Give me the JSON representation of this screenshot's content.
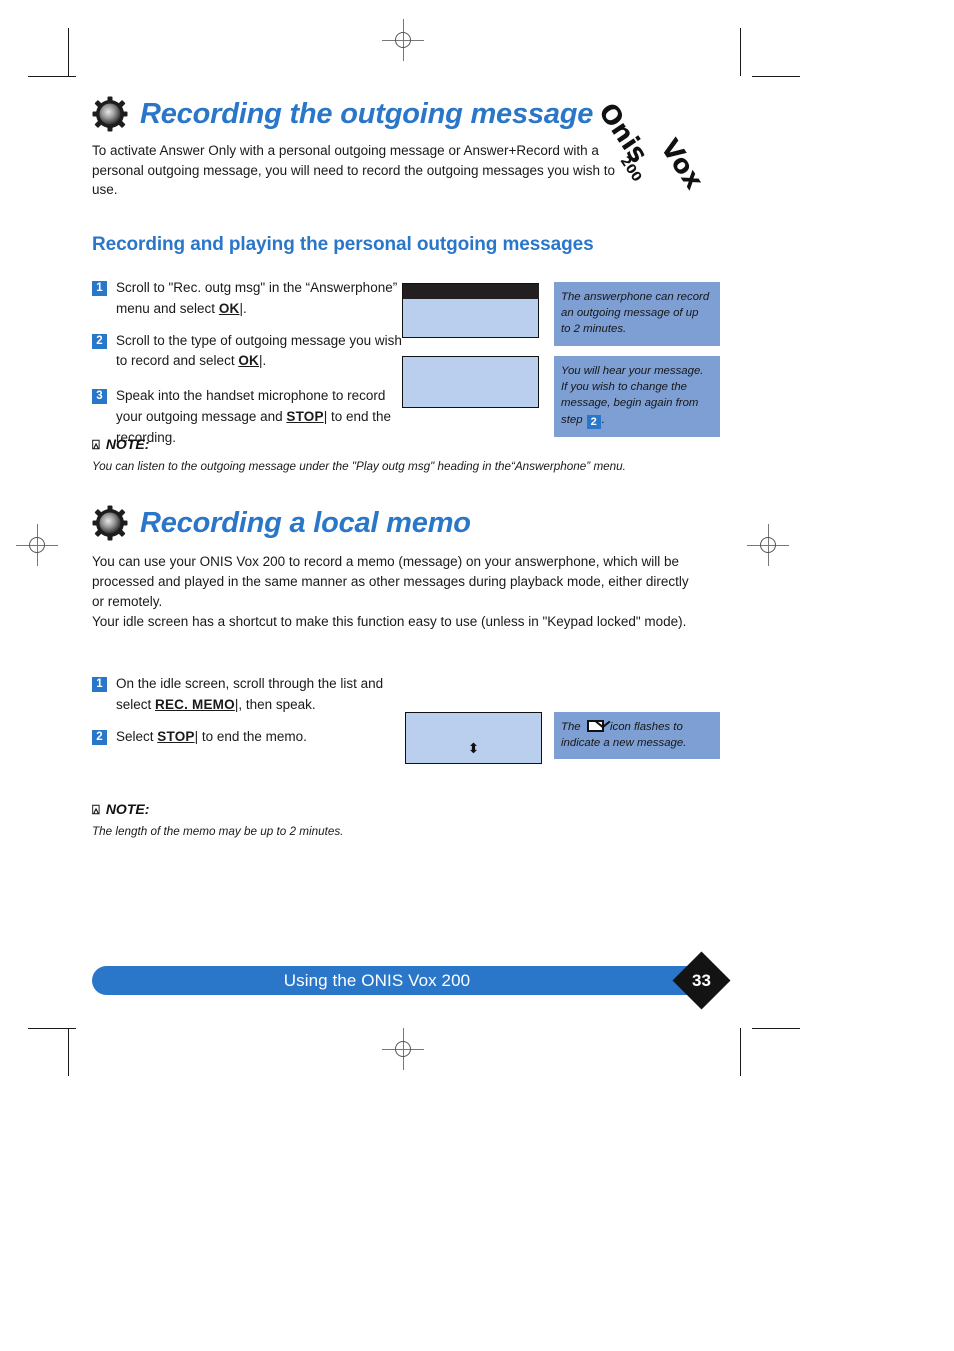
{
  "logo": {
    "brand": "Onis",
    "model": "Vox",
    "number": "200"
  },
  "section1": {
    "icon": "gear-icon",
    "title": "Recording the outgoing message",
    "intro": "To activate Answer Only with a personal outgoing message or Answer+Record with a personal outgoing message, you will need to record the outgoing messages you wish to use.",
    "subtitle": "Recording and playing the personal outgoing messages",
    "steps": [
      {
        "num": "1",
        "parts": [
          {
            "t": "Scroll to \"Rec. outg msg\" in the “Answerphone” menu and select "
          },
          {
            "t": "OK",
            "key": true
          },
          {
            "t": "|."
          }
        ]
      },
      {
        "num": "2",
        "parts": [
          {
            "t": "Scroll to the type of outgoing message you wish to record and select "
          },
          {
            "t": "OK",
            "key": true
          },
          {
            "t": "|."
          }
        ]
      },
      {
        "num": "3",
        "parts": [
          {
            "t": "Speak into the handset microphone to record your outgoing message and "
          },
          {
            "t": "STOP",
            "key": true
          },
          {
            "t": "| to end the recording."
          }
        ]
      }
    ],
    "notes": [
      {
        "text": "The answerphone can record an outgoing message of up to 2 minutes."
      },
      {
        "pre": "You will hear your message. If you wish to change the message, begin again from step ",
        "badge": "2",
        "post": "."
      }
    ],
    "note_label": "NOTE:",
    "note_icon": "note-pointer-icon",
    "note_text": "You can listen to the outgoing message under the \"Play outg msg\" heading in the“Answerphone” menu."
  },
  "section2": {
    "icon": "gear-icon",
    "title": "Recording a local memo",
    "para1": "You can use your ONIS Vox 200 to record a memo (message) on your answerphone, which will be processed and played in the same manner as other messages during playback mode, either directly or remotely.",
    "para2": "Your idle screen has a shortcut to make this function easy to use (unless in \"Keypad locked\" mode).",
    "steps": [
      {
        "num": "1",
        "parts": [
          {
            "t": "On the idle screen, scroll through the list and select "
          },
          {
            "t": "REC. MEMO",
            "key": true
          },
          {
            "t": "|, then speak."
          }
        ]
      },
      {
        "num": "2",
        "parts": [
          {
            "t": "Select "
          },
          {
            "t": "STOP",
            "key": true
          },
          {
            "t": "| to end the memo."
          }
        ]
      }
    ],
    "screen_glyph": "⬍",
    "note_side": {
      "pre": "The ",
      "icon": "envelope-icon",
      "post": " icon flashes to indicate a new message."
    },
    "note_label": "NOTE:",
    "note_icon": "note-pointer-icon",
    "note_text": "The length of the memo may be up to 2 minutes."
  },
  "footer": {
    "title": "Using the ONIS Vox 200",
    "page": "33"
  },
  "colors": {
    "accent": "#2a76c8",
    "lcd": "#bacfee",
    "sidenote": "#7d9fd3",
    "dark": "#231f20"
  }
}
